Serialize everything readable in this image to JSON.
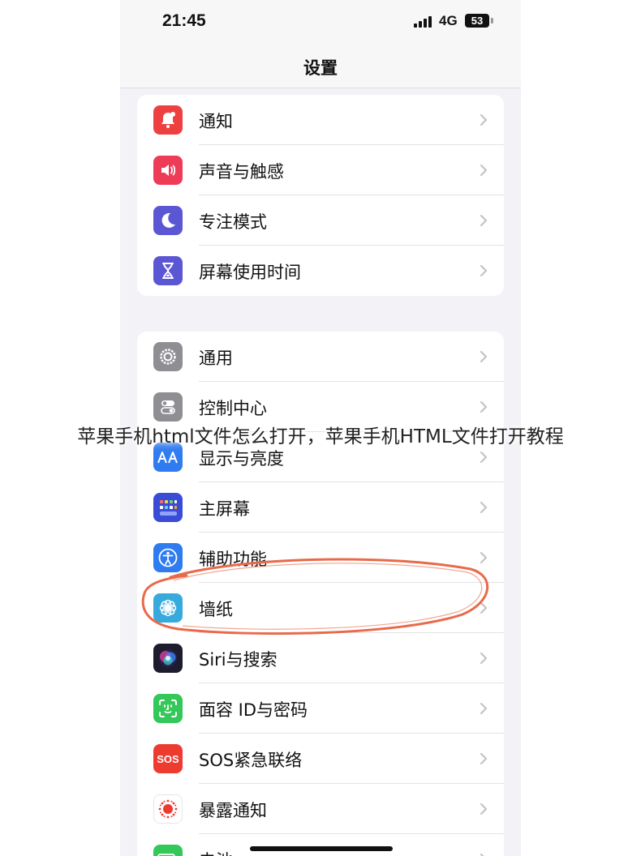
{
  "status_bar": {
    "time": "21:45",
    "network": "4G",
    "battery": "53"
  },
  "nav": {
    "title": "设置"
  },
  "groups": [
    {
      "items": [
        {
          "label": "通知",
          "icon": "bell-icon",
          "color": "#ee4040"
        },
        {
          "label": "声音与触感",
          "icon": "speaker-icon",
          "color": "#ee3b58"
        },
        {
          "label": "专注模式",
          "icon": "moon-icon",
          "color": "#5b56d4"
        },
        {
          "label": "屏幕使用时间",
          "icon": "hourglass-icon",
          "color": "#5b56d4"
        }
      ]
    },
    {
      "items": [
        {
          "label": "通用",
          "icon": "gear-icon",
          "color": "#8e8e93"
        },
        {
          "label": "控制中心",
          "icon": "toggles-icon",
          "color": "#8e8e93"
        },
        {
          "label": "显示与亮度",
          "icon": "text-size-icon",
          "color": "#2f7bf0"
        },
        {
          "label": "主屏幕",
          "icon": "home-grid-icon",
          "color": "#3a4bd6"
        },
        {
          "label": "辅助功能",
          "icon": "accessibility-icon",
          "color": "#2f7bf0"
        },
        {
          "label": "墙纸",
          "icon": "flower-icon",
          "color": "#36aadc"
        },
        {
          "label": "Siri与搜索",
          "icon": "siri-icon",
          "color": "#1c1c2e"
        },
        {
          "label": "面容 ID与密码",
          "icon": "face-id-icon",
          "color": "#34c759"
        },
        {
          "label": "SOS紧急联络",
          "icon": "sos-icon",
          "color": "#ee3b30",
          "icon_text": "SOS"
        },
        {
          "label": "暴露通知",
          "icon": "exposure-icon",
          "color": "#ffffff"
        },
        {
          "label": "电池",
          "icon": "battery-icon",
          "color": "#34c759"
        }
      ]
    }
  ],
  "overlay_caption": "苹果手机html文件怎么打开，苹果手机HTML文件打开教程"
}
